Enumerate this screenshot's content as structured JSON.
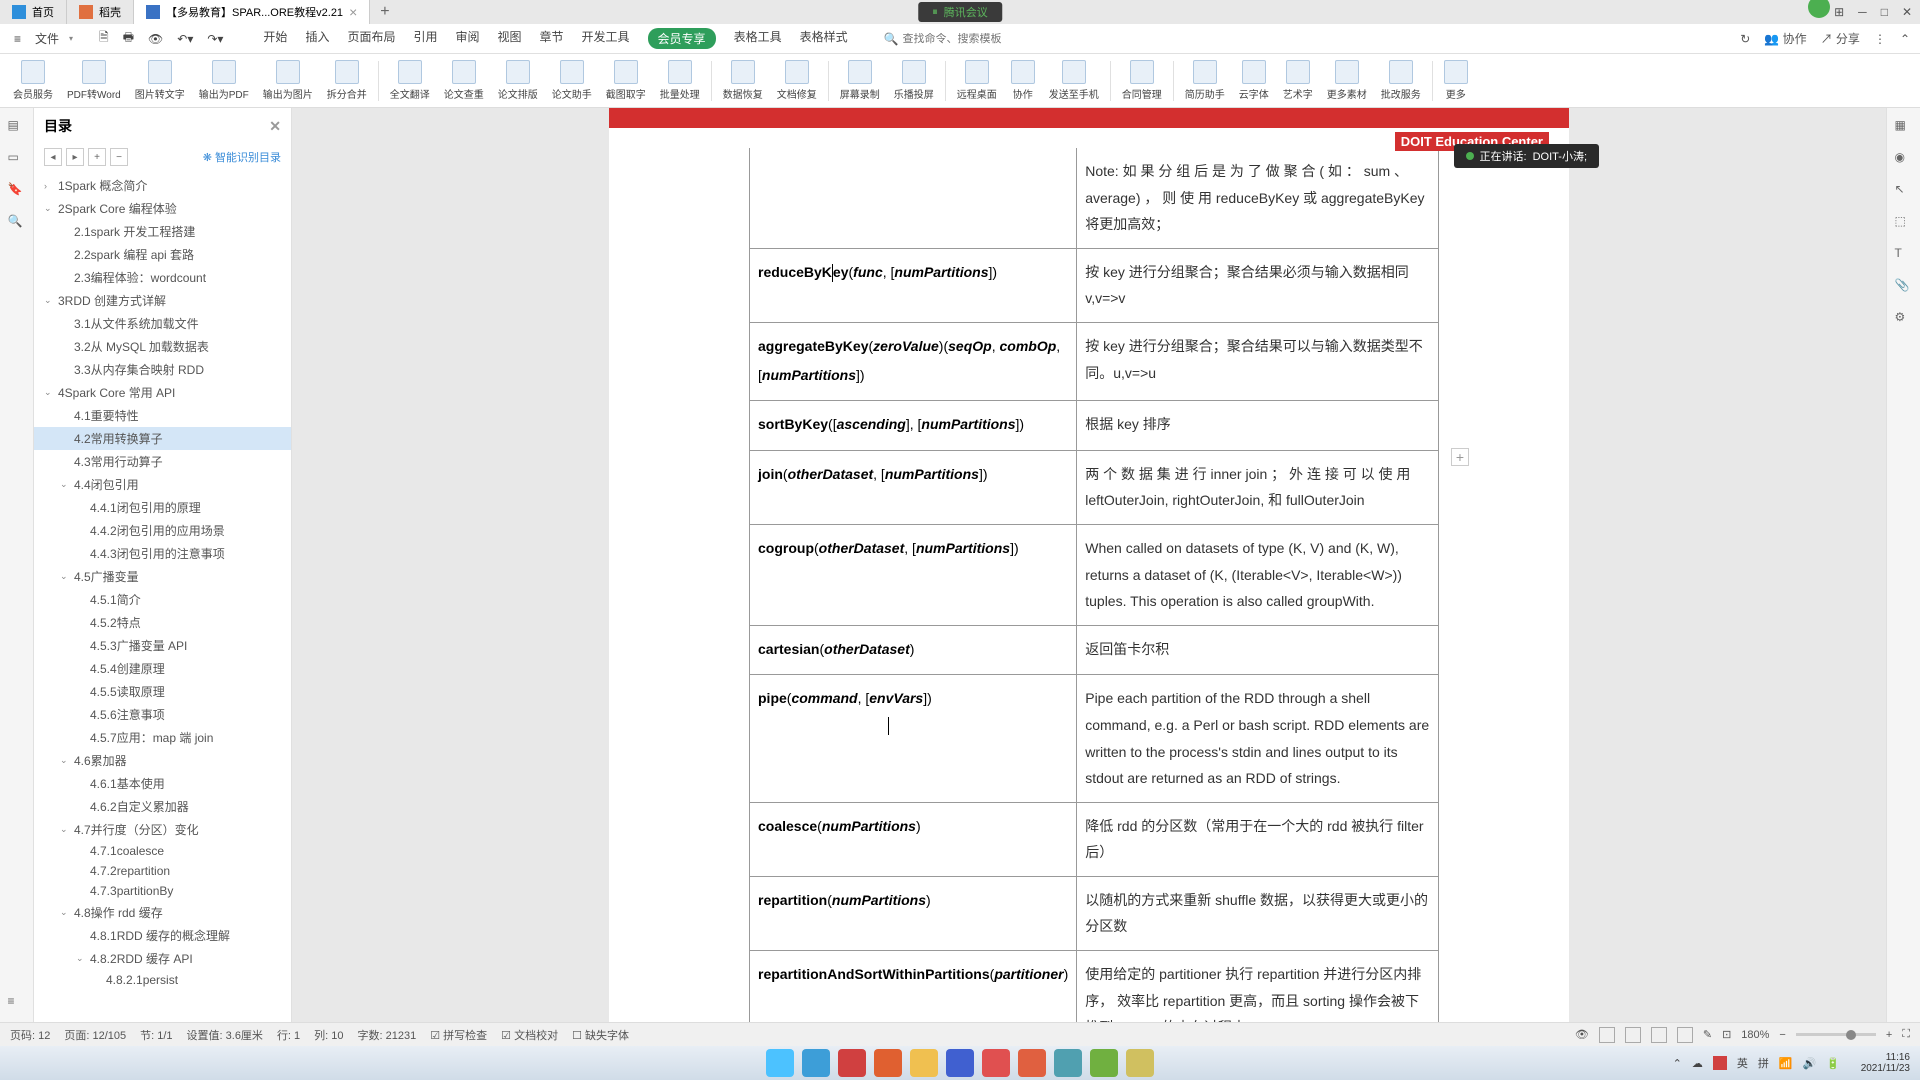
{
  "titlebar": {
    "tabs": [
      {
        "label": "首页",
        "active": false,
        "color": "#2e8fdb"
      },
      {
        "label": "稻壳",
        "active": false,
        "color": "#e07040"
      },
      {
        "label": "【多易教育】SPAR...ORE教程v2.21",
        "active": true,
        "color": "#3a72c4"
      }
    ],
    "meeting": "腾讯会议"
  },
  "toolbar": {
    "file": "文件",
    "menus": [
      "开始",
      "插入",
      "页面布局",
      "引用",
      "审阅",
      "视图",
      "章节",
      "开发工具",
      "会员专享",
      "表格工具",
      "表格样式"
    ],
    "vip_index": 8,
    "search_placeholder": "查找命令、搜索模板",
    "right": {
      "coop": "协作",
      "share": "分享"
    }
  },
  "ribbon": [
    "会员服务",
    "PDF转Word",
    "图片转文字",
    "输出为PDF",
    "输出为图片",
    "拆分合并",
    "全文翻译",
    "论文查重",
    "论文排版",
    "论文助手",
    "截图取字",
    "批量处理",
    "数据恢复",
    "文档修复",
    "屏幕录制",
    "乐播投屏",
    "远程桌面",
    "协作",
    "发送至手机",
    "合同管理",
    "简历助手",
    "云字体",
    "艺术字",
    "更多素材",
    "批改服务",
    "更多"
  ],
  "outline": {
    "title": "目录",
    "smart": "智能识别目录",
    "items": [
      {
        "level": 1,
        "chev": ">",
        "text": "1Spark 概念简介"
      },
      {
        "level": 1,
        "chev": "v",
        "text": "2Spark Core 编程体验"
      },
      {
        "level": 2,
        "chev": "",
        "text": "2.1spark 开发工程搭建"
      },
      {
        "level": 2,
        "chev": "",
        "text": "2.2spark 编程 api 套路"
      },
      {
        "level": 2,
        "chev": "",
        "text": "2.3编程体验：wordcount"
      },
      {
        "level": 1,
        "chev": "v",
        "text": "3RDD 创建方式详解"
      },
      {
        "level": 2,
        "chev": "",
        "text": "3.1从文件系统加载文件"
      },
      {
        "level": 2,
        "chev": "",
        "text": "3.2从 MySQL 加载数据表"
      },
      {
        "level": 2,
        "chev": "",
        "text": "3.3从内存集合映射 RDD"
      },
      {
        "level": 1,
        "chev": "v",
        "text": "4Spark Core 常用 API"
      },
      {
        "level": 2,
        "chev": "",
        "text": "4.1重要特性"
      },
      {
        "level": 2,
        "chev": "",
        "text": "4.2常用转换算子",
        "active": true
      },
      {
        "level": 2,
        "chev": "",
        "text": "4.3常用行动算子"
      },
      {
        "level": 2,
        "chev": "v",
        "text": "4.4闭包引用"
      },
      {
        "level": 3,
        "chev": "",
        "text": "4.4.1闭包引用的原理"
      },
      {
        "level": 3,
        "chev": "",
        "text": "4.4.2闭包引用的应用场景"
      },
      {
        "level": 3,
        "chev": "",
        "text": "4.4.3闭包引用的注意事项"
      },
      {
        "level": 2,
        "chev": "v",
        "text": "4.5广播变量"
      },
      {
        "level": 3,
        "chev": "",
        "text": "4.5.1简介"
      },
      {
        "level": 3,
        "chev": "",
        "text": "4.5.2特点"
      },
      {
        "level": 3,
        "chev": "",
        "text": "4.5.3广播变量 API"
      },
      {
        "level": 3,
        "chev": "",
        "text": "4.5.4创建原理"
      },
      {
        "level": 3,
        "chev": "",
        "text": "4.5.5读取原理"
      },
      {
        "level": 3,
        "chev": "",
        "text": "4.5.6注意事项"
      },
      {
        "level": 3,
        "chev": "",
        "text": "4.5.7应用：map 端 join"
      },
      {
        "level": 2,
        "chev": "v",
        "text": "4.6累加器"
      },
      {
        "level": 3,
        "chev": "",
        "text": "4.6.1基本使用"
      },
      {
        "level": 3,
        "chev": "",
        "text": "4.6.2自定义累加器"
      },
      {
        "level": 2,
        "chev": "v",
        "text": "4.7并行度（分区）变化"
      },
      {
        "level": 3,
        "chev": "",
        "text": "4.7.1coalesce"
      },
      {
        "level": 3,
        "chev": "",
        "text": "4.7.2repartition"
      },
      {
        "level": 3,
        "chev": "",
        "text": "4.7.3partitionBy"
      },
      {
        "level": 2,
        "chev": "v",
        "text": "4.8操作 rdd 缓存"
      },
      {
        "level": 3,
        "chev": "",
        "text": "4.8.1RDD 缓存的概念理解"
      },
      {
        "level": 3,
        "chev": "v",
        "text": "4.8.2RDD 缓存 API"
      },
      {
        "level": 4,
        "chev": "",
        "text": "4.8.2.1persist"
      }
    ]
  },
  "doc": {
    "brand": "DOIT Education Center",
    "speaking_prefix": "正在讲话: ",
    "speaking_name": "DOIT-小涛;",
    "table": [
      {
        "api": "",
        "desc_note": "Note: 如 果 分 组 后 是 为 了 做 聚 合 ( 如 ： sum 、 average) ， 则 使 用 reduceByKey 或 aggregateByKey 将更加高效；",
        "note": true
      },
      {
        "api_parts": [
          {
            "t": "reduceByK",
            "b": 1
          },
          {
            "t": "ey",
            "b": 1,
            "cursor": true
          },
          {
            "t": "(",
            "b": 0
          },
          {
            "t": "func",
            "i": 1,
            "b": 1
          },
          {
            "t": ", [",
            "b": 0
          },
          {
            "t": "numPartitions",
            "i": 1,
            "b": 1
          },
          {
            "t": "])",
            "b": 0
          }
        ],
        "desc": "按 key 进行分组聚合；聚合结果必须与输入数据相同 v,v=>v"
      },
      {
        "api_parts": [
          {
            "t": "aggregateByKey",
            "b": 1
          },
          {
            "t": "(",
            "b": 0
          },
          {
            "t": "zeroValue",
            "i": 1,
            "b": 1
          },
          {
            "t": ")(",
            "b": 0
          },
          {
            "t": "seqOp",
            "i": 1,
            "b": 1
          },
          {
            "t": ", ",
            "b": 0
          },
          {
            "t": "combOp",
            "i": 1,
            "b": 1
          },
          {
            "t": ", [",
            "b": 0
          },
          {
            "t": "numPartitions",
            "i": 1,
            "b": 1
          },
          {
            "t": "])",
            "b": 0
          }
        ],
        "desc": "按 key 进行分组聚合；聚合结果可以与输入数据类型不同。u,v=>u"
      },
      {
        "api_parts": [
          {
            "t": "sortByKey",
            "b": 1
          },
          {
            "t": "([",
            "b": 0
          },
          {
            "t": "ascending",
            "i": 1,
            "b": 1
          },
          {
            "t": "], [",
            "b": 0
          },
          {
            "t": "numPartitions",
            "i": 1,
            "b": 1
          },
          {
            "t": "])",
            "b": 0
          }
        ],
        "desc": "根据 key 排序"
      },
      {
        "api_parts": [
          {
            "t": "join",
            "b": 1
          },
          {
            "t": "(",
            "b": 0
          },
          {
            "t": "otherDataset",
            "i": 1,
            "b": 1
          },
          {
            "t": ", [",
            "b": 0
          },
          {
            "t": "numPartitions",
            "i": 1,
            "b": 1
          },
          {
            "t": "])",
            "b": 0
          }
        ],
        "desc": "两 个 数 据 集 进 行 inner join ； 外 连 接 可 以 使 用 leftOuterJoin, rightOuterJoin, 和 fullOuterJoin"
      },
      {
        "api_parts": [
          {
            "t": "cogroup",
            "b": 1
          },
          {
            "t": "(",
            "b": 0
          },
          {
            "t": "otherDataset",
            "i": 1,
            "b": 1
          },
          {
            "t": ", [",
            "b": 0
          },
          {
            "t": "numPartitions",
            "i": 1,
            "b": 1
          },
          {
            "t": "])",
            "b": 0
          }
        ],
        "desc": "When called on datasets of type (K, V) and (K, W), returns a dataset of (K, (Iterable<V>, Iterable<W>)) tuples. This operation is also called groupWith."
      },
      {
        "api_parts": [
          {
            "t": "cartesian",
            "b": 1
          },
          {
            "t": "(",
            "b": 0
          },
          {
            "t": "otherDataset",
            "i": 1,
            "b": 1
          },
          {
            "t": ")",
            "b": 0
          }
        ],
        "desc": "返回笛卡尔积"
      },
      {
        "api_parts": [
          {
            "t": "pipe",
            "b": 1
          },
          {
            "t": "(",
            "b": 0
          },
          {
            "t": "command",
            "i": 1,
            "b": 1
          },
          {
            "t": ", [",
            "b": 0
          },
          {
            "t": "envVars",
            "i": 1,
            "b": 1
          },
          {
            "t": "])",
            "b": 0
          }
        ],
        "desc": "Pipe each partition of the RDD through a shell command, e.g. a Perl or bash script. RDD elements are written to the process's stdin and lines output to its stdout are returned as an RDD of strings."
      },
      {
        "api_parts": [
          {
            "t": "coalesce",
            "b": 1
          },
          {
            "t": "(",
            "b": 0
          },
          {
            "t": "numPartitions",
            "i": 1,
            "b": 1
          },
          {
            "t": ")",
            "b": 0
          }
        ],
        "desc": "降低 rdd 的分区数（常用于在一个大的 rdd 被执行 filter 后）"
      },
      {
        "api_parts": [
          {
            "t": "repartition",
            "b": 1
          },
          {
            "t": "(",
            "b": 0
          },
          {
            "t": "numPartitions",
            "i": 1,
            "b": 1
          },
          {
            "t": ")",
            "b": 0
          }
        ],
        "desc": "以随机的方式来重新 shuffle 数据，以获得更大或更小的分区数"
      },
      {
        "api_parts": [
          {
            "t": "repartitionAndSortWithinPartitions",
            "b": 1
          },
          {
            "t": "(",
            "b": 0
          },
          {
            "t": "partitioner",
            "i": 1,
            "b": 1
          },
          {
            "t": ")",
            "b": 0
          }
        ],
        "desc": "使用给定的 partitioner 执行 repartition 并进行分区内排序， 效率比 repartition 更高，而且 sorting 操作会被下推到 shuffle 的内在过程中"
      }
    ]
  },
  "statusbar": {
    "page": "页码: 12",
    "pages": "页面: 12/105",
    "section": "节: 1/1",
    "setval": "设置值: 3.6厘米",
    "row": "行: 1",
    "col": "列: 10",
    "chars": "字数: 21231",
    "spell": "拼写检查",
    "proof": "文档校对",
    "missing": "缺失字体",
    "zoom": "180%"
  },
  "taskbar": {
    "time": "11:16",
    "date": "2021/11/23",
    "ime": [
      "英",
      "拼"
    ]
  }
}
